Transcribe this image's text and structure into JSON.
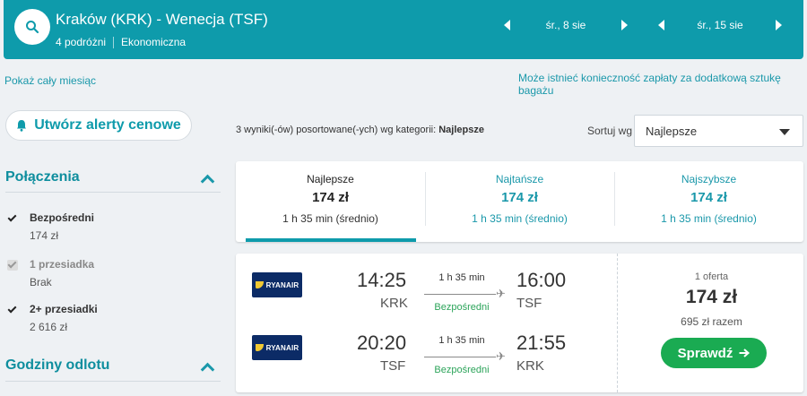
{
  "header": {
    "route": "Kraków (KRK) - Wenecja (TSF)",
    "travelers": "4 podróżni",
    "cabin": "Ekonomiczna",
    "depart_date": "śr., 8 sie",
    "return_date": "śr., 15 sie"
  },
  "links": {
    "whole_month": "Pokaż cały miesiąc",
    "baggage_note": "Może istnieć konieczność zapłaty za dodatkową sztukę bagażu"
  },
  "alert_button": {
    "label": "Utwórz alerty cenowe"
  },
  "results": {
    "info_prefix": "3 wyniki(-ów) posortowane(-ych) wg kategorii:",
    "info_category": "Najlepsze",
    "sort_label": "Sortuj wg",
    "sort_value": "Najlepsze"
  },
  "sidebar": {
    "connections_title": "Połączenia",
    "options": [
      {
        "label": "Bezpośredni",
        "price": "174 zł",
        "checked": true,
        "disabled": false
      },
      {
        "label": "1 przesiadka",
        "price": "Brak",
        "checked": true,
        "disabled": true
      },
      {
        "label": "2+ przesiadki",
        "price": "2 616 zł",
        "checked": true,
        "disabled": false
      }
    ],
    "departure_title": "Godziny odlotu"
  },
  "tabs": [
    {
      "name": "Najlepsze",
      "price": "174 zł",
      "duration": "1 h 35 min (średnio)"
    },
    {
      "name": "Najtańsze",
      "price": "174 zł",
      "duration": "1 h 35 min (średnio)"
    },
    {
      "name": "Najszybsze",
      "price": "174 zł",
      "duration": "1 h 35 min (średnio)"
    }
  ],
  "result": {
    "airline": "RYANAIR",
    "legs": [
      {
        "dep_time": "14:25",
        "dep_code": "KRK",
        "duration": "1 h 35 min",
        "stops": "Bezpośredni",
        "arr_time": "16:00",
        "arr_code": "TSF"
      },
      {
        "dep_time": "20:20",
        "dep_code": "TSF",
        "duration": "1 h 35 min",
        "stops": "Bezpośredni",
        "arr_time": "21:55",
        "arr_code": "KRK"
      }
    ],
    "offers": "1 oferta",
    "price": "174 zł",
    "total": "695 zł razem",
    "button": "Sprawdź"
  },
  "colors": {
    "primary": "#0e9bab",
    "accent_text": "#1a98aa",
    "success": "#1aab52",
    "airline_bg": "#0c2b66"
  },
  "icons": {
    "search": "search-icon",
    "bell": "bell-icon",
    "plane": "plane-icon",
    "arrow": "arrow-right-icon"
  }
}
